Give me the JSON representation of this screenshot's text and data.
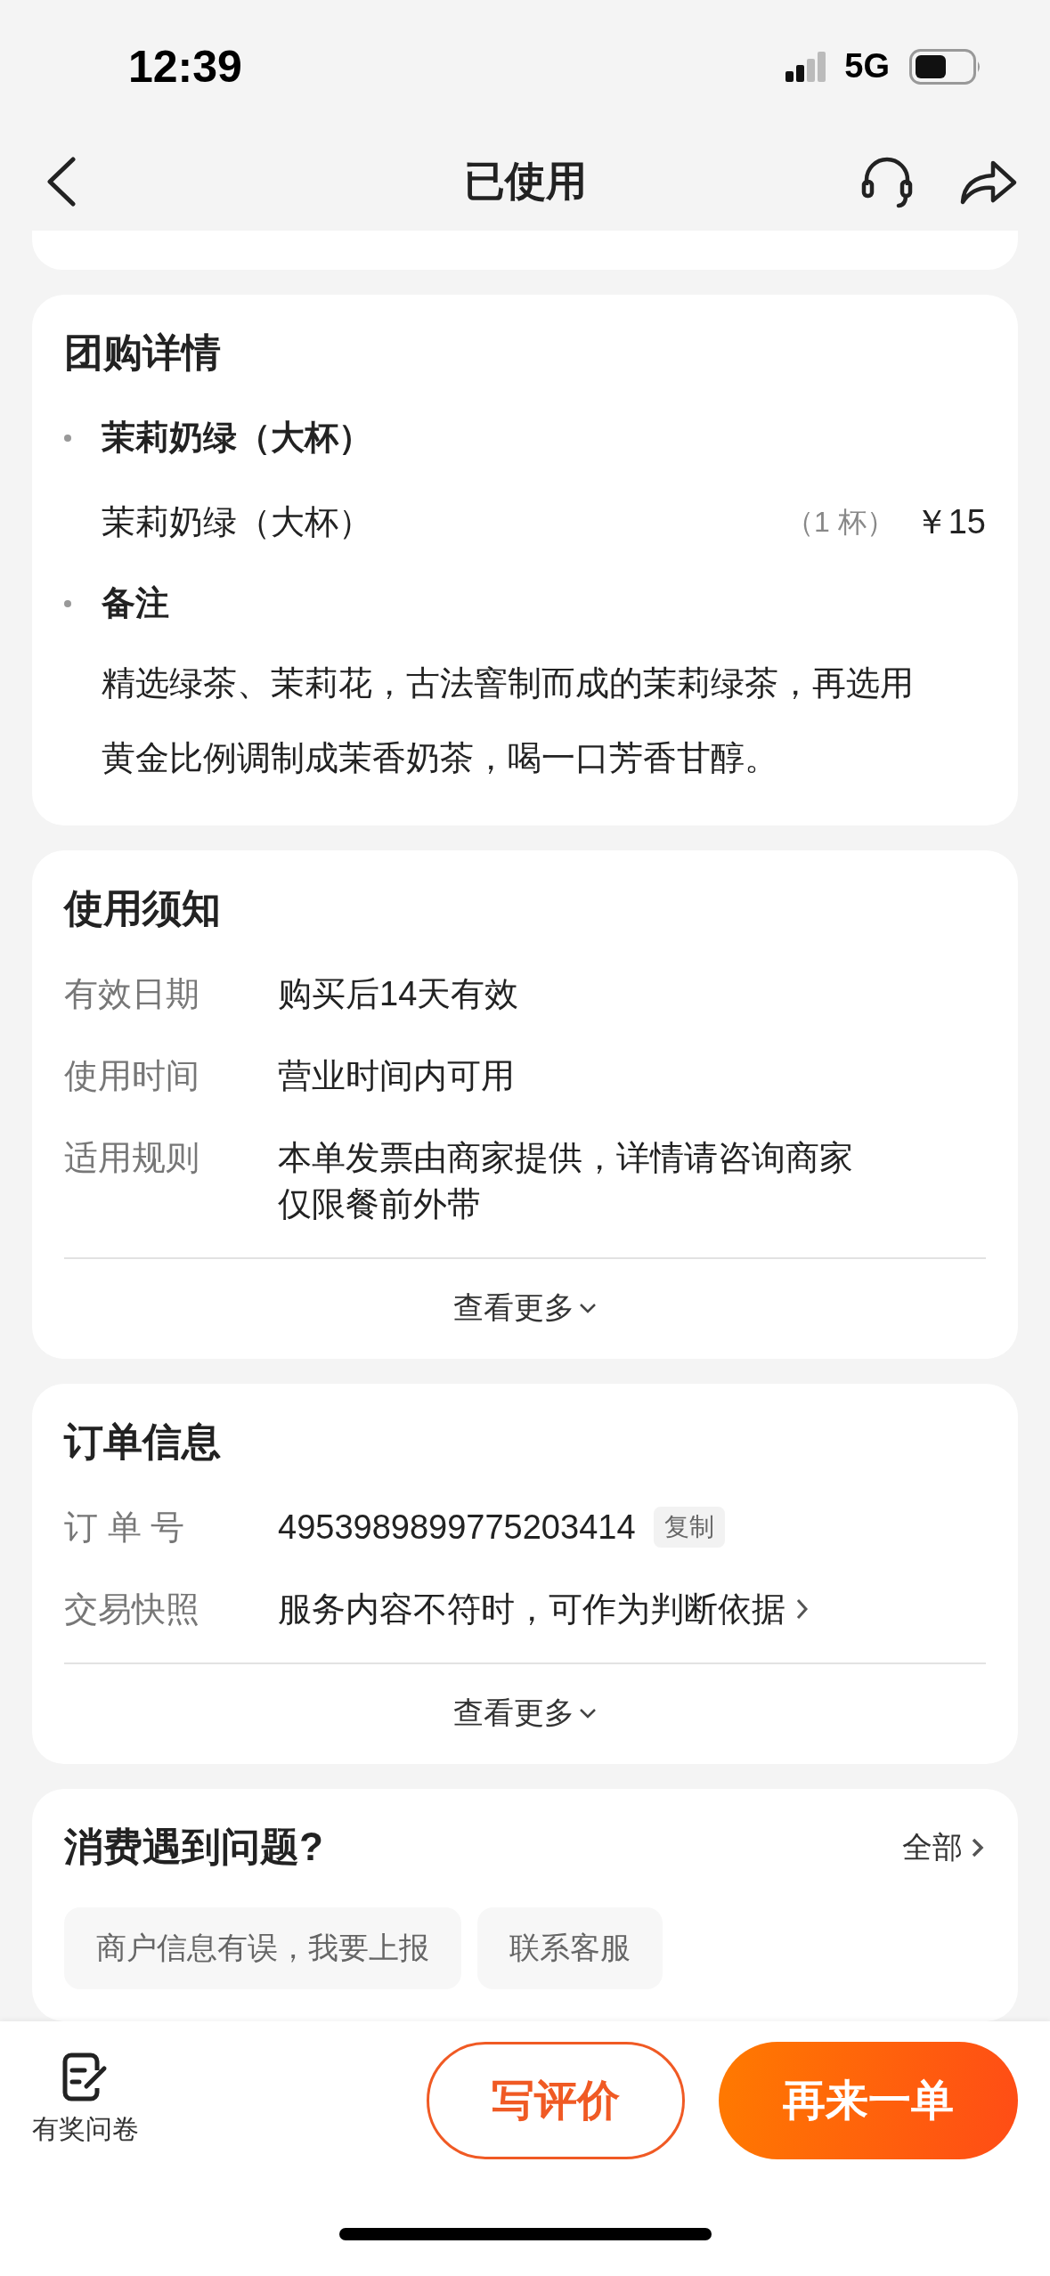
{
  "status_bar": {
    "time": "12:39",
    "network": "5G"
  },
  "header": {
    "title": "已使用"
  },
  "group_buy": {
    "title": "团购详情",
    "sections": [
      {
        "kind": "items",
        "heading": "茉莉奶绿（大杯）",
        "items": [
          {
            "name": "茉莉奶绿（大杯）",
            "quantity": "（1 杯）",
            "price": "￥15"
          }
        ]
      },
      {
        "kind": "note",
        "heading": "备注",
        "text": "精选绿茶、茉莉花，古法窨制而成的茉莉绿茶，再选用黄金比例调制成茉香奶茶，喝一口芳香甘醇。"
      }
    ]
  },
  "usage": {
    "title": "使用须知",
    "rows": [
      {
        "label": "有效日期",
        "lines": [
          "购买后14天有效"
        ]
      },
      {
        "label": "使用时间",
        "lines": [
          "营业时间内可用"
        ]
      },
      {
        "label": "适用规则",
        "lines": [
          "本单发票由商家提供，详情请咨询商家",
          "仅限餐前外带"
        ]
      }
    ],
    "more": "查看更多"
  },
  "order": {
    "title": "订单信息",
    "rows": [
      {
        "kind": "copy",
        "label": "订 单 号",
        "value": "4953989899775203414",
        "action": "复制"
      },
      {
        "kind": "link",
        "label": "交易快照",
        "value": "服务内容不符时，可作为判断依据"
      }
    ],
    "more": "查看更多"
  },
  "problems": {
    "title": "消费遇到问题?",
    "all": "全部",
    "chips": [
      "商户信息有误，我要上报",
      "联系客服"
    ]
  },
  "bottom_bar": {
    "survey": "有奖问卷",
    "buttons": [
      {
        "kind": "outline",
        "label": "写评价"
      },
      {
        "kind": "primary",
        "label": "再来一单"
      }
    ]
  }
}
